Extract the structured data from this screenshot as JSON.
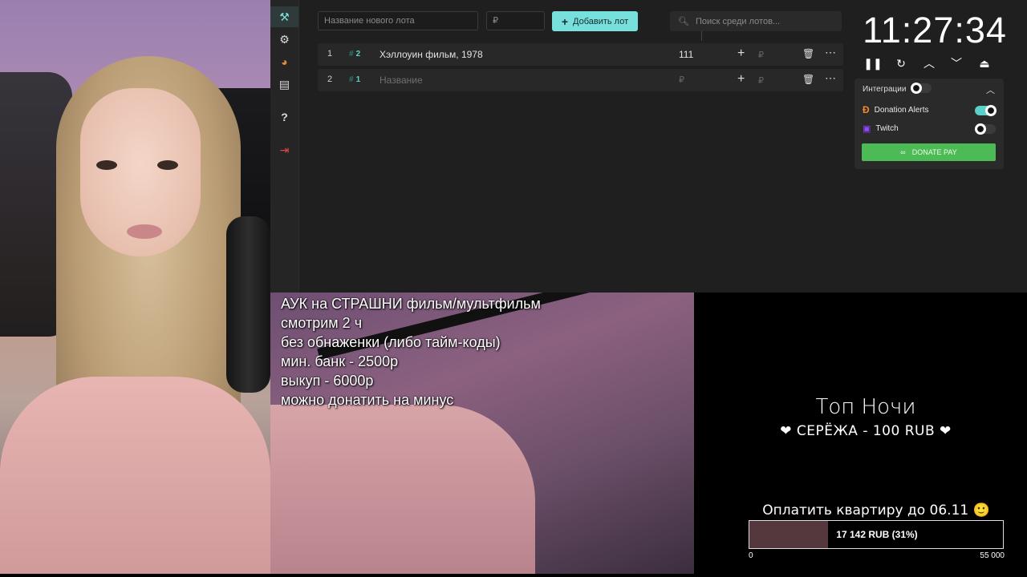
{
  "sidebar": {
    "items": [
      {
        "icon": "gavel-icon",
        "glyph": "⚒"
      },
      {
        "icon": "gear-icon",
        "glyph": "⚙"
      },
      {
        "icon": "pie-chart-icon",
        "glyph": "◕"
      },
      {
        "icon": "clipboard-icon",
        "glyph": "▤"
      },
      {
        "icon": "help-icon",
        "glyph": "?"
      },
      {
        "icon": "logout-icon",
        "glyph": "⇥"
      }
    ]
  },
  "toolbar": {
    "lot_name_placeholder": "Название нового лота",
    "lot_price_placeholder": "₽",
    "add_label": "Добавить лот",
    "search_placeholder": "Поиск среди лотов..."
  },
  "lots": [
    {
      "index": "1",
      "tag": "2",
      "name": "Хэллоуин фильм, 1978",
      "amount": "111",
      "rub": "₽"
    },
    {
      "index": "2",
      "tag": "1",
      "name": "Название",
      "amount": "₽",
      "rub": "₽"
    }
  ],
  "timer": {
    "time": "11:27:34",
    "controls": [
      "pause-icon",
      "restart-icon",
      "chevron-up-icon",
      "chevron-down-icon",
      "eject-icon"
    ]
  },
  "integrations": {
    "title": "Интеграции",
    "items": [
      {
        "name": "Donation Alerts",
        "enabled": true,
        "color": "#f08a2c"
      },
      {
        "name": "Twitch",
        "enabled": false,
        "color": "#9146ff"
      }
    ],
    "donate_label": "DONATE PAY"
  },
  "notes": [
    "АУК на СТРАШНИ фильм/мультфильм",
    "смотрим 2 ч",
    "без обнаженки (либо тайм-коды)",
    "мин. банк - 2500р",
    "выкуп - 6000р",
    "можно донатить на минус"
  ],
  "top_night": {
    "title": "Топ Ночи",
    "donor": "❤ СЕРЁЖА - 100 RUB ❤"
  },
  "goal": {
    "title": "Оплатить квартиру до 06.11 🙂",
    "label": "17 142 RUB (31%)",
    "progress": 0.31,
    "min": "0",
    "max": "55 000",
    "fill_color": "#54383d"
  },
  "colors": {
    "accent": "#78e0dc",
    "donate": "#4cba55",
    "panel": "#1f1f1f"
  }
}
